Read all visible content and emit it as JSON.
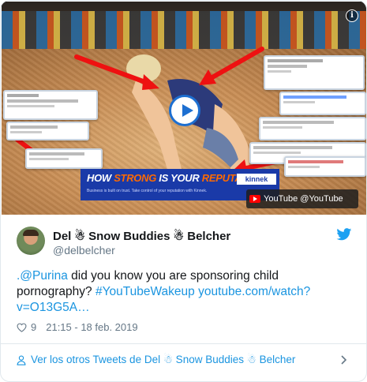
{
  "media": {
    "youtube_badge": "YouTube @YouTube",
    "banner_title_pre": "HOW ",
    "banner_title_hl1": "STRONG",
    "banner_title_mid": " IS YOUR ",
    "banner_title_hl2": "REPUTATION?",
    "banner_sub": "Business is built on trust. Take control of your reputation with Kinnek.",
    "banner_brand": "kinnek",
    "info_glyph": "i",
    "play_icon": "play-icon"
  },
  "tweet": {
    "author_name": "Del ☃ Snow Buddies ☃ Belcher",
    "handle": "@delbelcher",
    "text_mention": ".@Purina",
    "text_body": " did you know you are sponsoring child pornography? ",
    "text_hashtag": "#YouTubeWakeup",
    "text_space": " ",
    "text_link": "youtube.com/watch?v=O13G5A…",
    "likes": "9",
    "timestamp": "21:15 - 18 feb. 2019"
  },
  "footer": {
    "label": "Ver los otros Tweets de Del ☃ Snow Buddies ☃ Belcher"
  },
  "colors": {
    "link": "#1b95e0",
    "text": "#14171a",
    "muted": "#657786",
    "twitter_blue": "#1da1f2",
    "youtube_red": "#ff0000"
  }
}
